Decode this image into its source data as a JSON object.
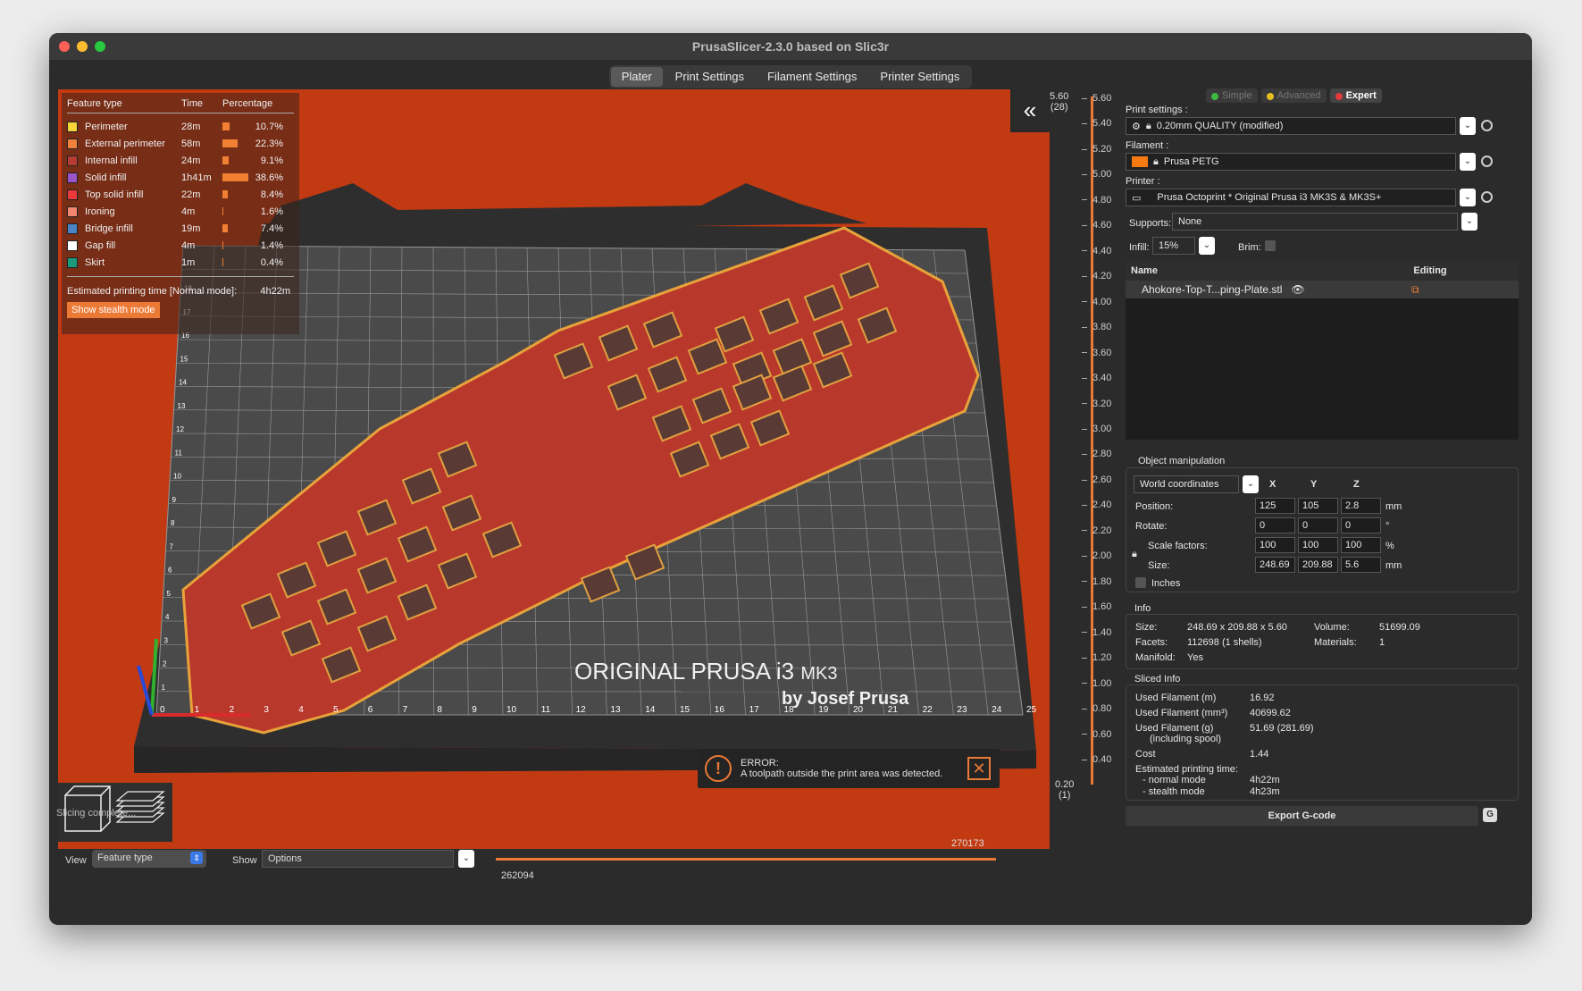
{
  "window": {
    "title": "PrusaSlicer-2.3.0 based on Slic3r"
  },
  "tabs": [
    {
      "label": "Plater"
    },
    {
      "label": "Print Settings"
    },
    {
      "label": "Filament Settings"
    },
    {
      "label": "Printer Settings"
    }
  ],
  "legend": {
    "headers": {
      "feature": "Feature type",
      "time": "Time",
      "percentage": "Percentage"
    },
    "rows": [
      {
        "name": "Perimeter",
        "time": "28m",
        "pct": "10.7%",
        "color": "#f7d438",
        "value": 10.7
      },
      {
        "name": "External perimeter",
        "time": "58m",
        "pct": "22.3%",
        "color": "#f1813a",
        "value": 22.3
      },
      {
        "name": "Internal infill",
        "time": "24m",
        "pct": "9.1%",
        "color": "#b73d34",
        "value": 9.1
      },
      {
        "name": "Solid infill",
        "time": "1h41m",
        "pct": "38.6%",
        "color": "#9b55c9",
        "value": 38.6
      },
      {
        "name": "Top solid infill",
        "time": "22m",
        "pct": "8.4%",
        "color": "#ec3a3a",
        "value": 8.4
      },
      {
        "name": "Ironing",
        "time": "4m",
        "pct": "1.6%",
        "color": "#f2866f",
        "value": 1.6
      },
      {
        "name": "Bridge infill",
        "time": "19m",
        "pct": "7.4%",
        "color": "#4b83c7",
        "value": 7.4
      },
      {
        "name": "Gap fill",
        "time": "4m",
        "pct": "1.4%",
        "color": "#ffffff",
        "value": 1.4
      },
      {
        "name": "Skirt",
        "time": "1m",
        "pct": "0.4%",
        "color": "#1b9a7c",
        "value": 0.4
      }
    ],
    "estimated_label": "Estimated printing time [Normal mode]:",
    "estimated_value": "4h22m",
    "stealth_button": "Show stealth mode"
  },
  "bed": {
    "title_line1": "ORIGINAL PRUSA i3",
    "title_mk": "MK3",
    "title_line2": "by Josef Prusa",
    "x_ticks": [
      "0",
      "1",
      "2",
      "3",
      "4",
      "5",
      "6",
      "7",
      "8",
      "9",
      "10",
      "11",
      "12",
      "13",
      "14",
      "15",
      "16",
      "17",
      "18",
      "19",
      "20",
      "21",
      "22",
      "23",
      "24",
      "25"
    ],
    "y_ticks": [
      "1",
      "2",
      "3",
      "4",
      "5",
      "6",
      "7",
      "8",
      "9",
      "10",
      "11",
      "12",
      "13",
      "14",
      "15",
      "16",
      "17",
      "18"
    ]
  },
  "error": {
    "title": "ERROR:",
    "message": "A toolpath outside the print area was detected."
  },
  "bottom": {
    "view_label": "View",
    "view_value": "Feature type",
    "show_label": "Show",
    "show_value": "Options",
    "slider_low": "262094",
    "slider_high": "270173"
  },
  "vslider": {
    "top_value": "5.60",
    "top_layer": "(28)",
    "bottom_value": "0.20",
    "bottom_layer": "(1)",
    "ticks": [
      "5.60",
      "5.40",
      "5.20",
      "5.00",
      "4.80",
      "4.60",
      "4.40",
      "4.20",
      "4.00",
      "3.80",
      "3.60",
      "3.40",
      "3.20",
      "3.00",
      "2.80",
      "2.60",
      "2.40",
      "2.20",
      "2.00",
      "1.80",
      "1.60",
      "1.40",
      "1.20",
      "1.00",
      "0.80",
      "0.60",
      "0.40"
    ]
  },
  "sidebar": {
    "modes": [
      {
        "label": "Simple",
        "color": "#3fb93f"
      },
      {
        "label": "Advanced",
        "color": "#e5c020"
      },
      {
        "label": "Expert",
        "color": "#e33b3b"
      }
    ],
    "print_settings_label": "Print settings :",
    "print_settings_value": "0.20mm QUALITY (modified)",
    "filament_label": "Filament :",
    "filament_value": "Prusa PETG",
    "filament_color": "#f57a12",
    "printer_label": "Printer :",
    "printer_value": "Prusa Octoprint * Original Prusa i3 MK3S & MK3S+",
    "supports_label": "Supports:",
    "supports_value": "None",
    "infill_label": "Infill:",
    "infill_value": "15%",
    "brim_label": "Brim:",
    "list_name_header": "Name",
    "list_editing_header": "Editing",
    "object_name": "Ahokore-Top-T...ping-Plate.stl",
    "object_manipulation": {
      "title": "Object manipulation",
      "coord_system": "World coordinates",
      "axes": [
        "X",
        "Y",
        "Z"
      ],
      "position_label": "Position:",
      "position": [
        "125",
        "105",
        "2.8"
      ],
      "position_unit": "mm",
      "rotate_label": "Rotate:",
      "rotate": [
        "0",
        "0",
        "0"
      ],
      "rotate_unit": "°",
      "scale_label": "Scale factors:",
      "scale": [
        "100",
        "100",
        "100"
      ],
      "scale_unit": "%",
      "size_label": "Size:",
      "size": [
        "248.69",
        "209.88",
        "5.6"
      ],
      "size_unit": "mm",
      "inches_label": "Inches"
    },
    "info": {
      "title": "Info",
      "size_label": "Size:",
      "size_value": "248.69 x 209.88 x 5.60",
      "volume_label": "Volume:",
      "volume_value": "51699.09",
      "facets_label": "Facets:",
      "facets_value": "112698 (1 shells)",
      "materials_label": "Materials:",
      "materials_value": "1",
      "manifold_label": "Manifold:",
      "manifold_value": "Yes"
    },
    "sliced": {
      "title": "Sliced Info",
      "used_m_label": "Used Filament (m)",
      "used_m": "16.92",
      "used_mm3_label": "Used Filament (mm³)",
      "used_mm3": "40699.62",
      "used_g_label": "Used Filament (g)",
      "used_g_sub": "(including spool)",
      "used_g": "51.69 (281.69)",
      "cost_label": "Cost",
      "cost": "1.44",
      "est_label": "Estimated printing time:",
      "normal_label": "- normal mode",
      "normal": "4h22m",
      "stealth_label": "- stealth mode",
      "stealth": "4h23m"
    },
    "export_button": "Export G-code",
    "export_g": "G"
  },
  "status": "Slicing complete..."
}
